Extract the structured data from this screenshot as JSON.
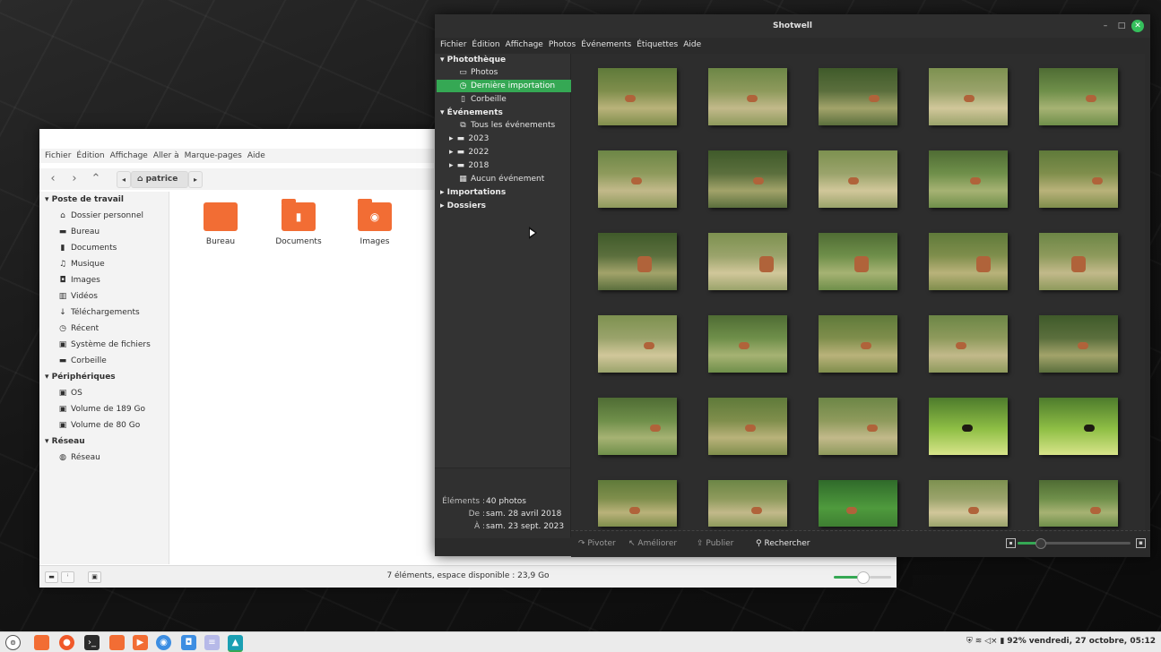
{
  "file_manager": {
    "menu": [
      "Fichier",
      "Édition",
      "Affichage",
      "Aller à",
      "Marque-pages",
      "Aide"
    ],
    "breadcrumb": "patrice",
    "sidebar": {
      "sections": [
        {
          "title": "Poste de travail",
          "items": [
            {
              "label": "Dossier personnel",
              "icon": "home-icon"
            },
            {
              "label": "Bureau",
              "icon": "desktop-icon"
            },
            {
              "label": "Documents",
              "icon": "document-icon"
            },
            {
              "label": "Musique",
              "icon": "music-icon"
            },
            {
              "label": "Images",
              "icon": "camera-icon"
            },
            {
              "label": "Vidéos",
              "icon": "film-icon"
            },
            {
              "label": "Téléchargements",
              "icon": "download-icon"
            },
            {
              "label": "Récent",
              "icon": "clock-icon"
            },
            {
              "label": "Système de fichiers",
              "icon": "drive-icon"
            },
            {
              "label": "Corbeille",
              "icon": "trash-icon"
            }
          ]
        },
        {
          "title": "Périphériques",
          "items": [
            {
              "label": "OS",
              "icon": "disk-icon"
            },
            {
              "label": "Volume de 189 Go",
              "icon": "disk-icon"
            },
            {
              "label": "Volume de 80 Go",
              "icon": "disk-icon"
            }
          ]
        },
        {
          "title": "Réseau",
          "items": [
            {
              "label": "Réseau",
              "icon": "network-icon"
            }
          ]
        }
      ]
    },
    "folders": [
      "Bureau",
      "Documents",
      "Images"
    ],
    "status": "7 éléments, espace disponible : 23,9 Go"
  },
  "shotwell": {
    "title": "Shotwell",
    "menu": [
      "Fichier",
      "Édition",
      "Affichage",
      "Photos",
      "Événements",
      "Étiquettes",
      "Aide"
    ],
    "library": {
      "title": "Photothèque",
      "items": [
        "Photos",
        "Dernière importation",
        "Corbeille"
      ],
      "selected": "Dernière importation"
    },
    "events": {
      "title": "Événements",
      "items": [
        "Tous les événements",
        "2023",
        "2022",
        "2018",
        "Aucun événement"
      ]
    },
    "imports_label": "Importations",
    "folders_label": "Dossiers",
    "info": {
      "elements_label": "Éléments :",
      "elements_value": "40 photos",
      "from_label": "De :",
      "from_value": "sam. 28 avril 2018",
      "to_label": "À :",
      "to_value": "sam. 23 sept. 2023"
    },
    "bottom": {
      "rotate": "Pivoter",
      "enhance": "Améliorer",
      "publish": "Publier",
      "search": "Rechercher"
    },
    "zoom_fraction": 0.2,
    "accent_color": "#35a854"
  },
  "taskbar": {
    "battery": "92%",
    "clock": "vendredi, 27 octobre, 05:12"
  }
}
